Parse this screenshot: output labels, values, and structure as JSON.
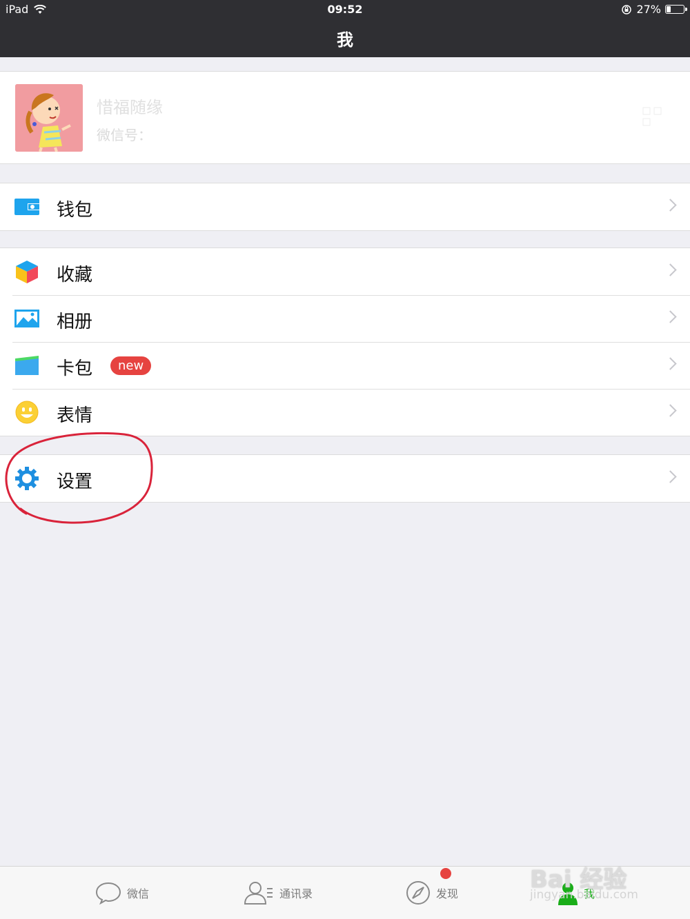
{
  "status_bar": {
    "device": "iPad",
    "time": "09:52",
    "battery": "27%",
    "battery_level": 0.27
  },
  "nav": {
    "title": "我"
  },
  "profile": {
    "name": "惜福随缘",
    "wechat_id_label": "微信号："
  },
  "wallet_group": [
    {
      "label": "钱包",
      "icon": "wallet-icon"
    }
  ],
  "main_group": [
    {
      "label": "收藏",
      "icon": "favorites-cube-icon"
    },
    {
      "label": "相册",
      "icon": "album-picture-icon"
    },
    {
      "label": "卡包",
      "icon": "card-wallet-icon",
      "badge": "new"
    },
    {
      "label": "表情",
      "icon": "smiley-face-icon"
    }
  ],
  "settings_group": [
    {
      "label": "设置",
      "icon": "gear-icon"
    }
  ],
  "tabs": [
    {
      "label": "微信",
      "icon": "chat-bubble-icon"
    },
    {
      "label": "通讯录",
      "icon": "contacts-icon"
    },
    {
      "label": "发现",
      "icon": "compass-icon"
    },
    {
      "label": "我",
      "icon": "person-icon",
      "active": true
    }
  ],
  "watermark": {
    "line1": "Bai 经验",
    "line2": "jingyan.baidu.com"
  },
  "colors": {
    "header_bg": "#2f2f33",
    "page_bg": "#efeff4",
    "active_tab": "#1aad19",
    "badge_red": "#e64340",
    "annotation_red": "#d9233a"
  }
}
